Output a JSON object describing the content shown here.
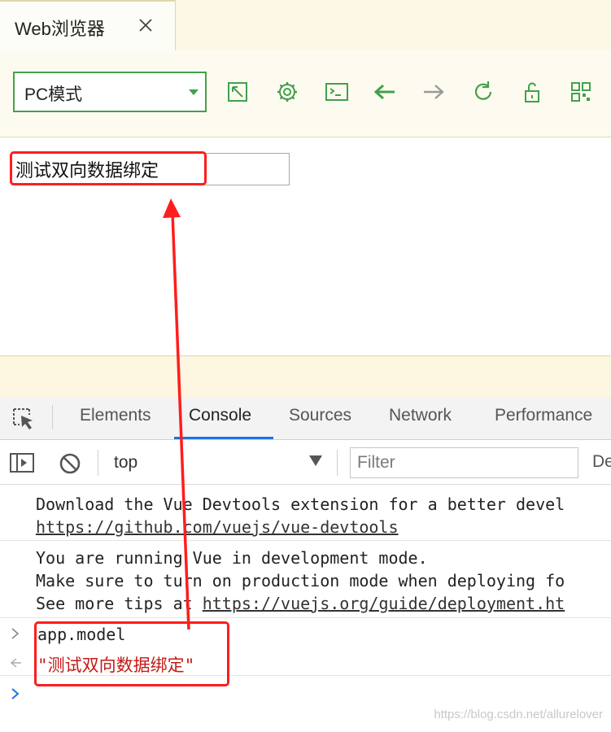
{
  "browser": {
    "tab_title": "Web浏览器",
    "mode_select": "PC模式",
    "toolbar_icons": [
      "open-external-icon",
      "settings-gear-icon",
      "terminal-icon",
      "back-arrow-icon",
      "forward-arrow-icon",
      "refresh-icon",
      "unlock-icon",
      "qr-code-icon"
    ]
  },
  "page": {
    "input_value": "测试双向数据绑定"
  },
  "devtools": {
    "tabs": [
      "Elements",
      "Console",
      "Sources",
      "Network",
      "Performance"
    ],
    "active_tab": "Console",
    "context": "top",
    "filter_placeholder": "Filter",
    "levels_partial": "De"
  },
  "console": {
    "msg1_line1": "Download the Vue Devtools extension for a better devel",
    "msg1_link": "https://github.com/vuejs/vue-devtools",
    "msg2_line1": "You are running Vue in development mode.",
    "msg2_line2": "Make sure to turn on production mode when deploying fo",
    "msg2_line3_prefix": "See more tips at ",
    "msg2_link": "https://vuejs.org/guide/deployment.ht",
    "input_expr": "app.model",
    "result": "\"测试双向数据绑定\""
  },
  "colors": {
    "accent_green": "#43a04b",
    "highlight_red": "#ff1d1d",
    "console_blue": "#1a73e8",
    "string_red": "#c41a16"
  },
  "watermark": "https://blog.csdn.net/allurelover"
}
